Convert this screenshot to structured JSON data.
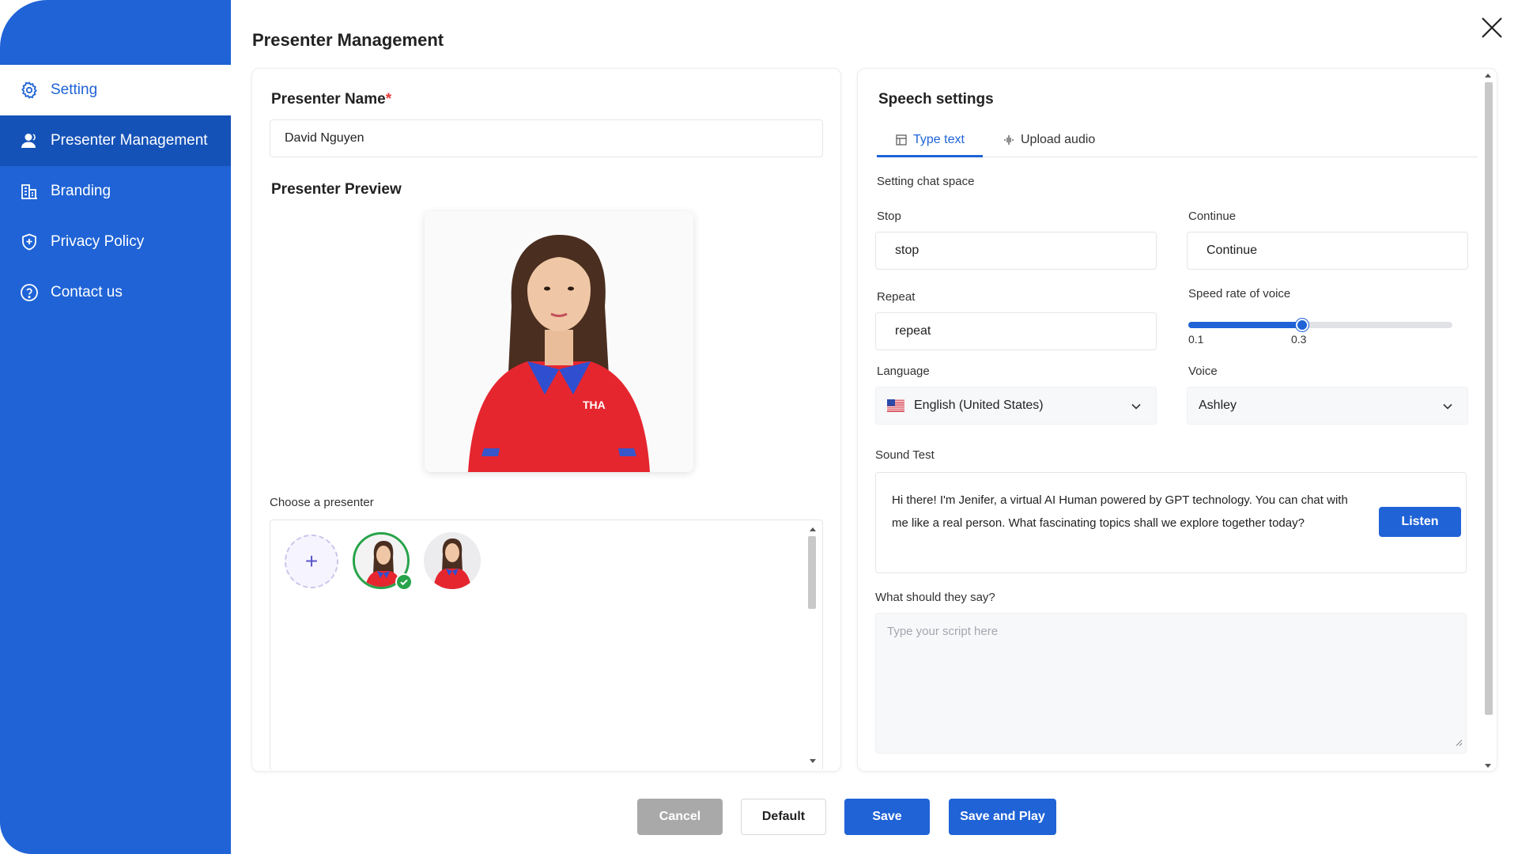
{
  "sidebar": {
    "items": [
      {
        "label": "Setting",
        "icon": "gear-icon"
      },
      {
        "label": "Presenter Management",
        "icon": "user-icon"
      },
      {
        "label": "Branding",
        "icon": "building-icon"
      },
      {
        "label": "Privacy Policy",
        "icon": "shield-icon"
      },
      {
        "label": "Contact us",
        "icon": "question-circle-icon"
      }
    ]
  },
  "page": {
    "title": "Presenter Management"
  },
  "left": {
    "name_label": "Presenter Name",
    "required_mark": "*",
    "name_value": "David Nguyen",
    "preview_label": "Presenter Preview",
    "choose_label": "Choose a presenter",
    "add_symbol": "+"
  },
  "speech": {
    "title": "Speech settings",
    "tabs": [
      {
        "label": "Type text"
      },
      {
        "label": "Upload audio"
      }
    ],
    "chat_space_label": "Setting chat space",
    "stop_label": "Stop",
    "stop_value": "stop",
    "continue_label": "Continue",
    "continue_value": "Continue",
    "repeat_label": "Repeat",
    "repeat_value": "repeat",
    "speed_label": "Speed rate of voice",
    "speed_min_label": "0.1",
    "speed_value_label": "0.3",
    "speed_fraction": 0.43,
    "language_label": "Language",
    "language_value": "English (United States)",
    "voice_label": "Voice",
    "voice_value": "Ashley",
    "sound_test_label": "Sound Test",
    "sound_test_text": "Hi there! I'm Jenifer, a virtual AI Human powered by GPT technology. You can chat with me like a real person. What fascinating topics shall we explore together today?",
    "listen_label": "Listen",
    "script_label": "What should they say?",
    "script_placeholder": "Type your script here"
  },
  "footer": {
    "cancel": "Cancel",
    "default": "Default",
    "save": "Save",
    "save_play": "Save and Play"
  },
  "colors": {
    "brand": "#1f63d6",
    "success": "#27a34a",
    "required": "#e53935"
  }
}
